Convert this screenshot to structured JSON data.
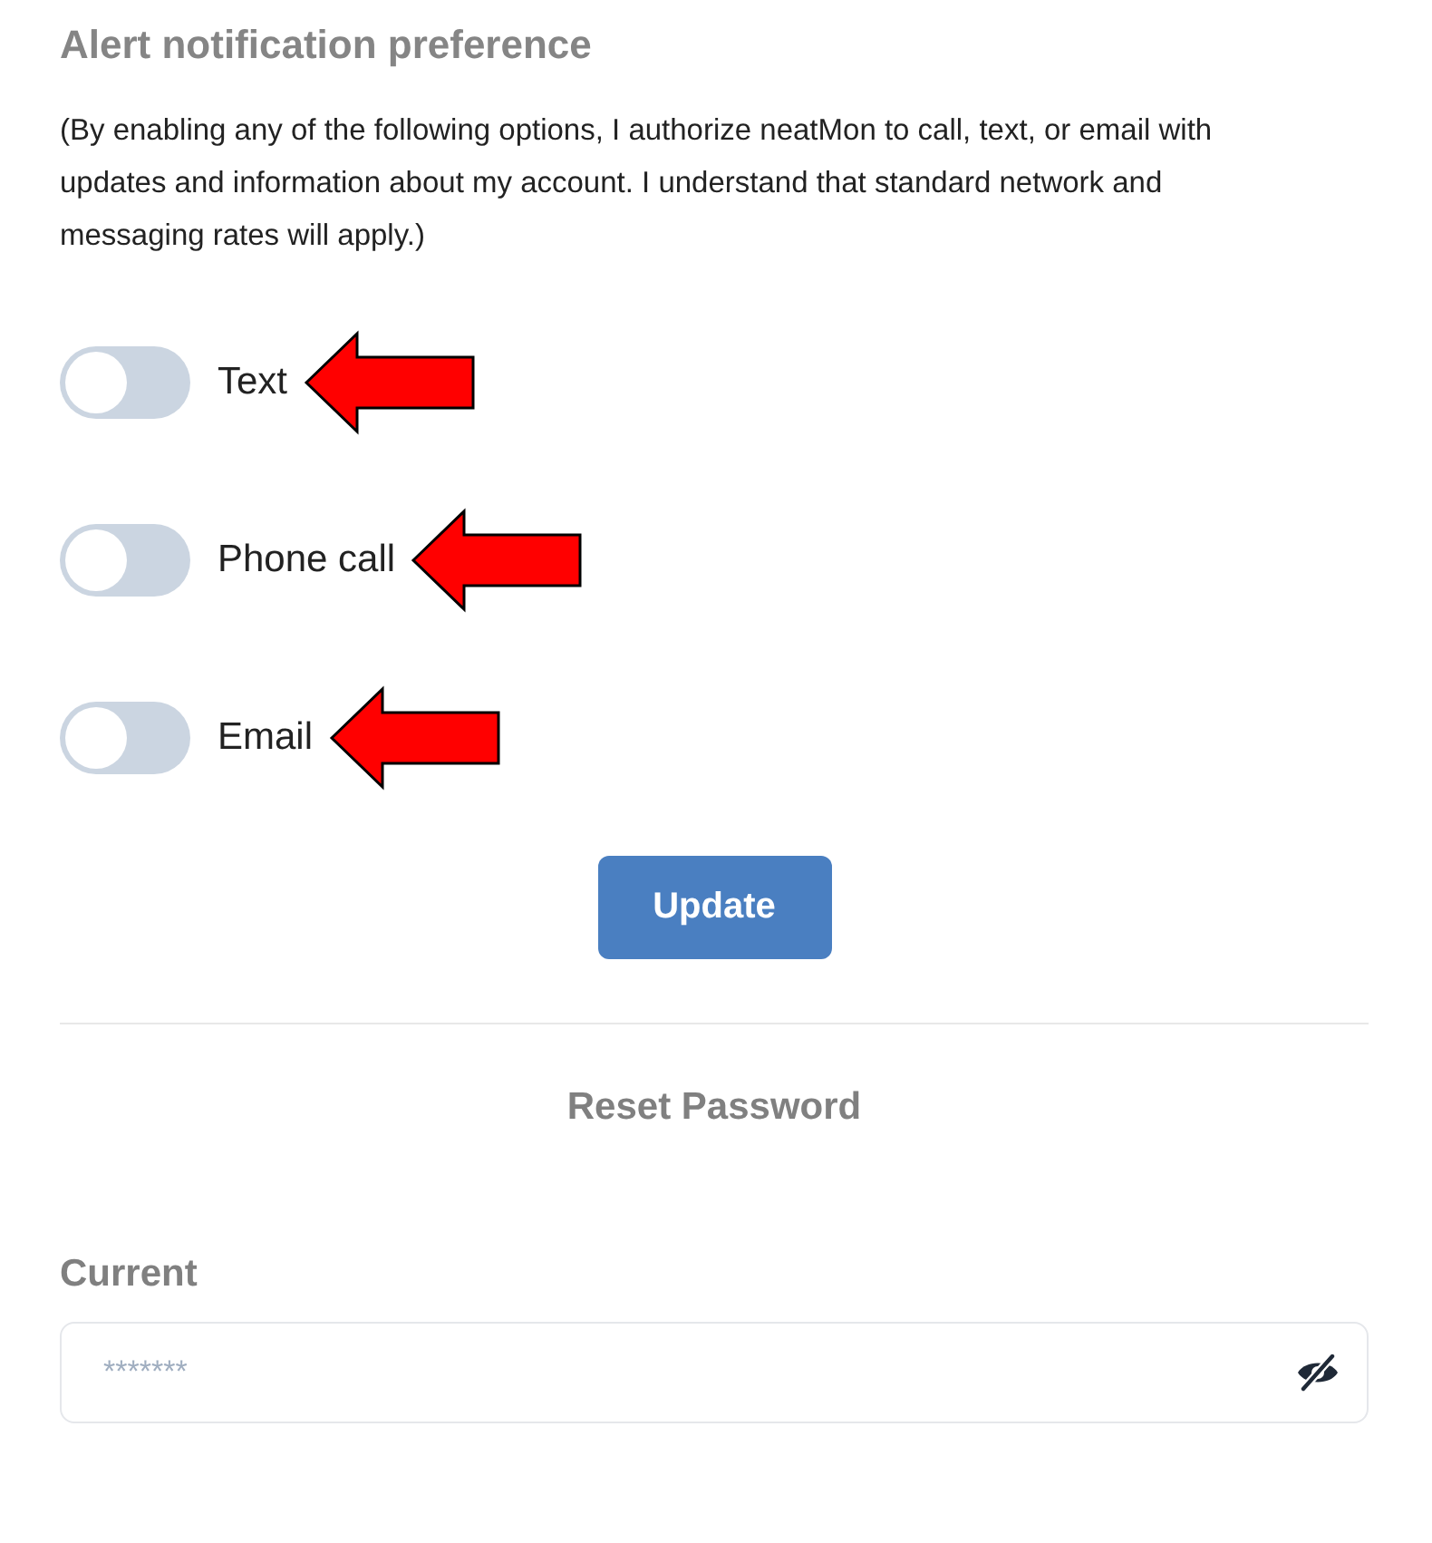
{
  "alerts": {
    "title": "Alert notification preference",
    "consent": "(By enabling any of the following options, I authorize neatMon to call, text, or email with updates and information about my account. I understand that standard network and messaging rates will apply.)",
    "toggles": [
      {
        "label": "Text",
        "on": false,
        "highlighted": true
      },
      {
        "label": "Phone call",
        "on": false,
        "highlighted": true
      },
      {
        "label": "Email",
        "on": false,
        "highlighted": true
      }
    ],
    "button": "Update"
  },
  "reset_password": {
    "title": "Reset Password",
    "fields": [
      {
        "label": "Current",
        "placeholder": "*******",
        "masked": true
      }
    ]
  }
}
